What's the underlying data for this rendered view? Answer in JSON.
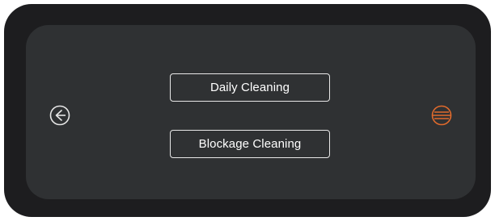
{
  "menu": {
    "daily_cleaning_label": "Daily Cleaning",
    "blockage_cleaning_label": "Blockage Cleaning"
  },
  "icons": {
    "back": "back-arrow-circle-icon",
    "menu": "menu-lines-circle-icon"
  },
  "colors": {
    "device_bezel": "#1d1d1f",
    "screen_background": "#2f3133",
    "button_border": "#e8e8e8",
    "text": "#ffffff",
    "back_icon": "#e6e6e6",
    "accent_icon": "#e06a2c"
  }
}
